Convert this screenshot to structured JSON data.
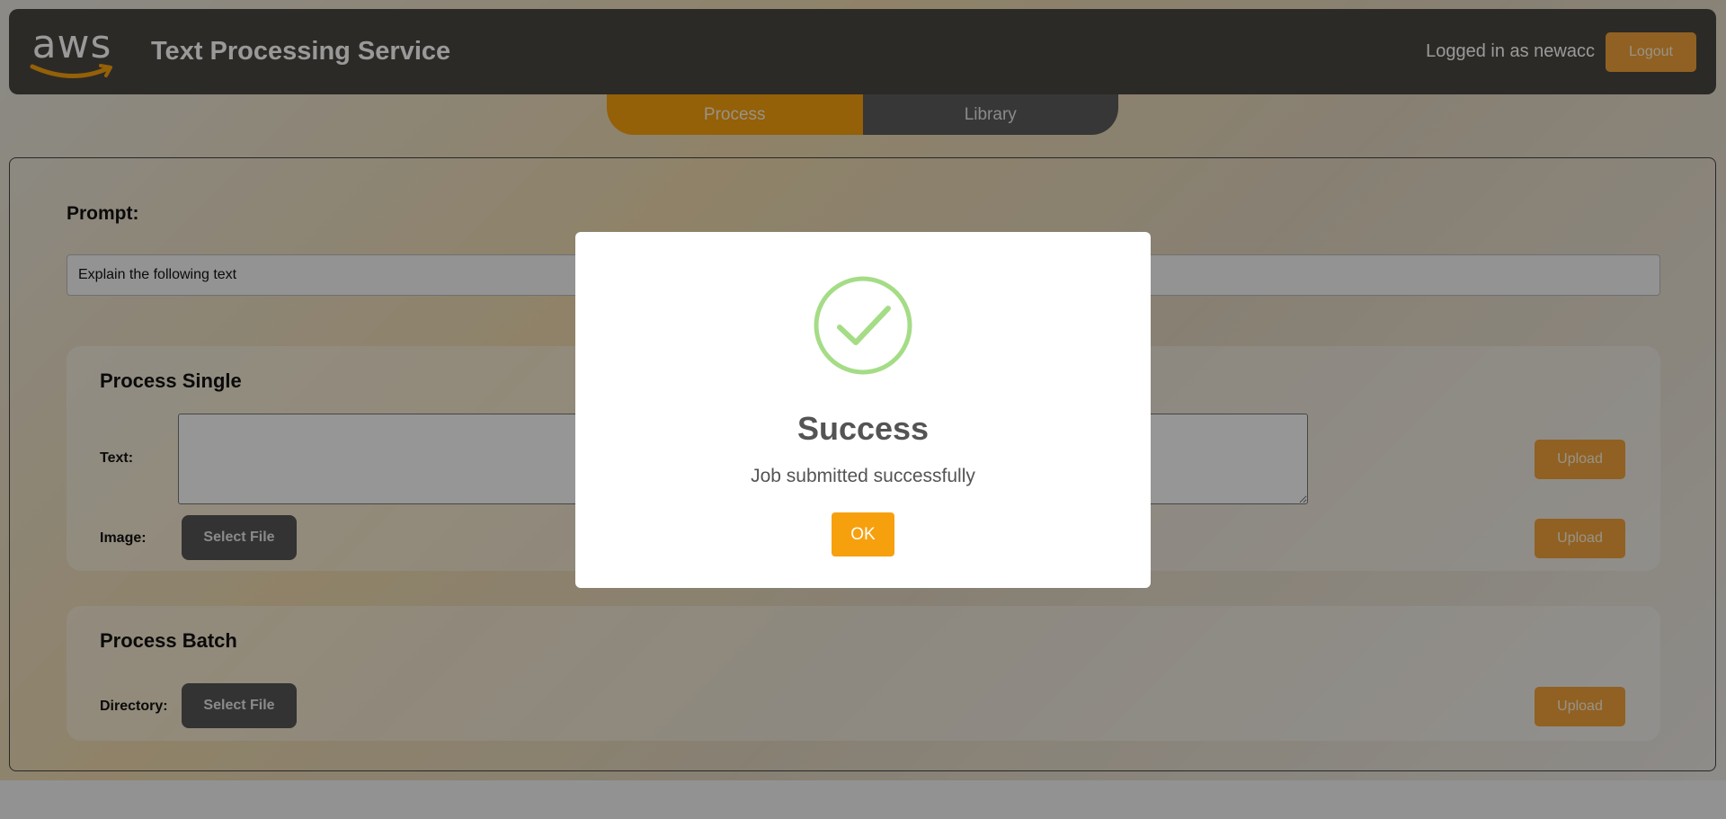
{
  "header": {
    "logo_text": "aws",
    "title": "Text Processing Service",
    "user_label": "Logged in as newacc",
    "logout_label": "Logout"
  },
  "tabs": [
    {
      "label": "Process",
      "active": true
    },
    {
      "label": "Library",
      "active": false
    }
  ],
  "prompt": {
    "label": "Prompt:",
    "value": "Explain the following text"
  },
  "process_single": {
    "title": "Process Single",
    "text_label": "Text:",
    "text_value": "",
    "image_label": "Image:",
    "select_file_label": "Select File",
    "upload_label": "Upload"
  },
  "process_batch": {
    "title": "Process Batch",
    "directory_label": "Directory:",
    "select_file_label": "Select File",
    "upload_label": "Upload"
  },
  "modal": {
    "icon": "check-circle-icon",
    "title": "Success",
    "message": "Job submitted successfully",
    "ok_label": "OK"
  },
  "colors": {
    "accent": "#f7a00e",
    "header_bg": "#4a4641",
    "success_green": "#a5dc86"
  }
}
